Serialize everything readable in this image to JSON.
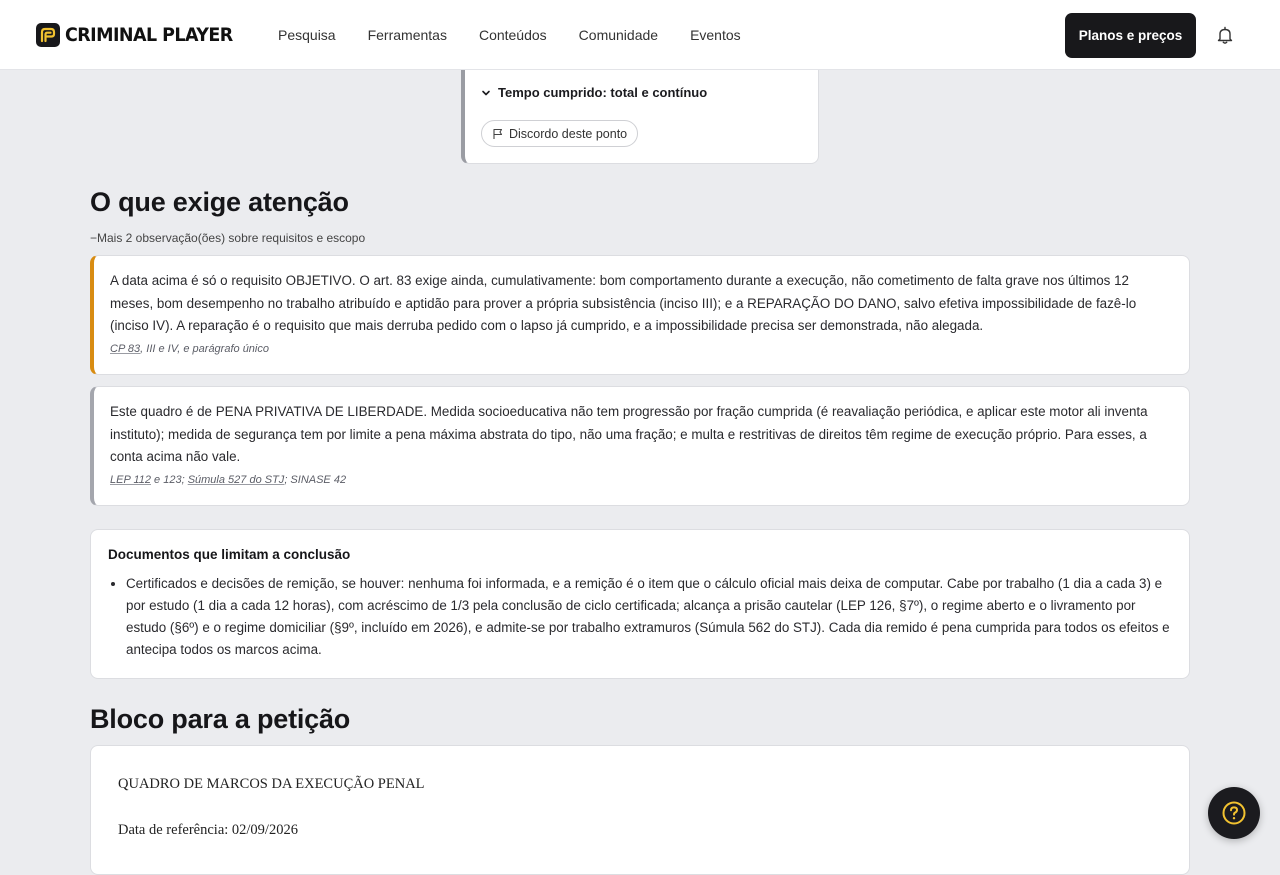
{
  "brand": {
    "name": "CRIMINAL PLAYER",
    "accent": "#f2c230"
  },
  "nav": {
    "items": [
      {
        "label": "Pesquisa"
      },
      {
        "label": "Ferramentas"
      },
      {
        "label": "Conteúdos"
      },
      {
        "label": "Comunidade"
      },
      {
        "label": "Eventos"
      }
    ],
    "plans_label": "Planos e preços"
  },
  "top_card": {
    "toggle_label": "Tempo cumprido: total e contínuo",
    "disagree_label": "Discordo deste ponto"
  },
  "attention": {
    "title": "O que exige atenção",
    "more_note": "−Mais 2 observação(ões) sobre requisitos e escopo",
    "notes": [
      {
        "text": "A data acima é só o requisito OBJETIVO. O art. 83 exige ainda, cumulativamente: bom comportamento durante a execução, não cometimento de falta grave nos últimos 12 meses, bom desempenho no trabalho atribuído e aptidão para prover a própria subsistência (inciso III); e a REPARAÇÃO DO DANO, salvo efetiva impossibilidade de fazê-lo (inciso IV). A reparação é o requisito que mais derruba pedido com o lapso já cumprido, e a impossibilidade precisa ser demonstrada, não alegada.",
        "ref_link": "CP 83",
        "ref_rest": ", III e IV, e parágrafo único",
        "accent": "#d88c12"
      },
      {
        "text": "Este quadro é de PENA PRIVATIVA DE LIBERDADE. Medida socioeducativa não tem progressão por fração cumprida (é reavaliação periódica, e aplicar este motor ali inventa instituto); medida de segurança tem por limite a pena máxima abstrata do tipo, não uma fração; e multa e restritivas de direitos têm regime de execução próprio. Para esses, a conta acima não vale.",
        "ref_link1": "LEP 112",
        "ref_mid1": " e 123; ",
        "ref_link2": "Súmula 527 do STJ",
        "ref_mid2": "; SINASE 42",
        "accent": "#a4a6ad"
      }
    ]
  },
  "documents": {
    "title": "Documentos que limitam a conclusão",
    "items": [
      "Certificados e decisões de remição, se houver: nenhuma foi informada, e a remição é o item que o cálculo oficial mais deixa de computar. Cabe por trabalho (1 dia a cada 3) e por estudo (1 dia a cada 12 horas), com acréscimo de 1/3 pela conclusão de ciclo certificada; alcança a prisão cautelar (LEP 126, §7º), o regime aberto e o livramento por estudo (§6º) e o regime domiciliar (§9º, incluído em 2026), e admite-se por trabalho extramuros (Súmula 562 do STJ). Cada dia remido é pena cumprida para todos os efeitos e antecipa todos os marcos acima."
    ]
  },
  "petition": {
    "title": "Bloco para a petição",
    "line1": "QUADRO DE MARCOS DA EXECUÇÃO PENAL",
    "line2": "Data de referência: 02/09/2026"
  },
  "icons": {
    "bell": "bell-icon",
    "help": "help-circle-icon",
    "flag": "flag-icon",
    "chevron": "chevron-down-icon"
  }
}
